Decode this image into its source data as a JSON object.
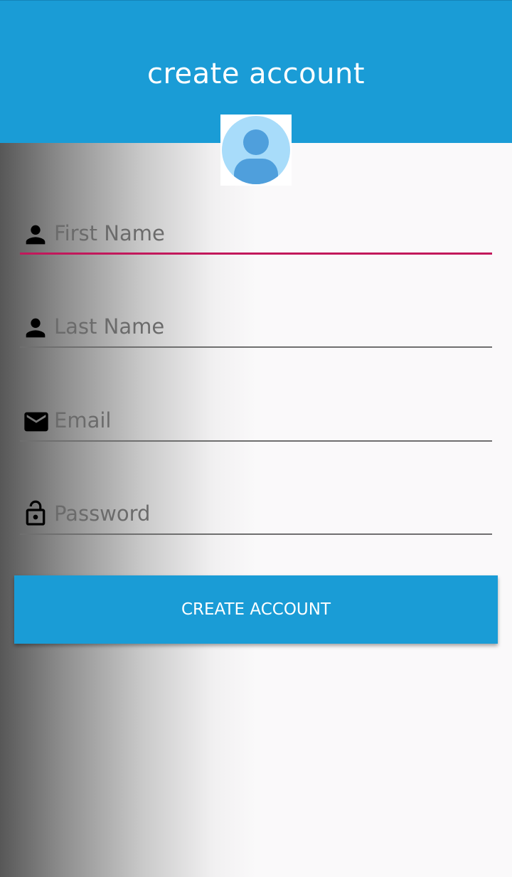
{
  "header": {
    "title": "create account",
    "color": "#1a9cd6"
  },
  "avatar": {
    "icon": "user-avatar-icon",
    "color": "#a8dcfa"
  },
  "form": {
    "first_name": {
      "placeholder": "First Name",
      "value": "",
      "icon": "person-icon",
      "focused": true
    },
    "last_name": {
      "placeholder": "Last Name",
      "value": "",
      "icon": "person-icon"
    },
    "email": {
      "placeholder": "Email",
      "value": "",
      "icon": "mail-icon"
    },
    "password": {
      "placeholder": "Password",
      "value": "",
      "icon": "lock-open-icon"
    },
    "focus_color": "#c2185b"
  },
  "submit": {
    "label": "CREATE ACCOUNT"
  }
}
